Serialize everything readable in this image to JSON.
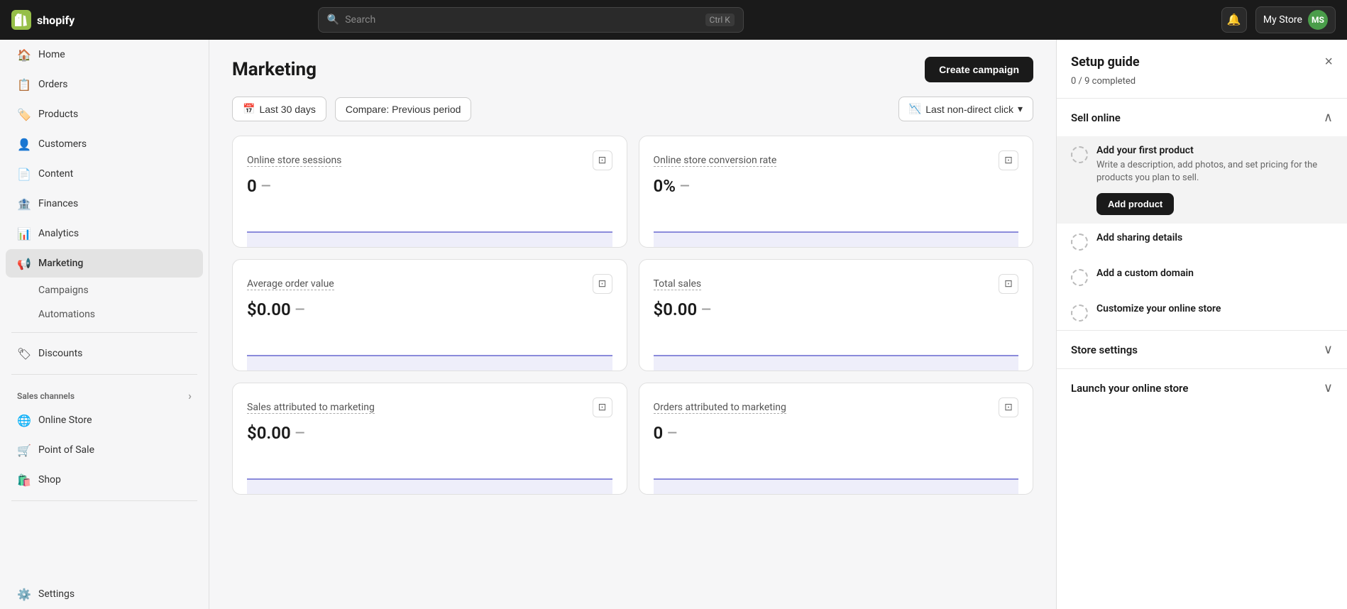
{
  "topnav": {
    "logo_text": "shopify",
    "logo_initials": "S",
    "search_placeholder": "Search",
    "search_shortcut": "Ctrl K",
    "store_name": "My Store",
    "avatar_initials": "MS"
  },
  "sidebar": {
    "items": [
      {
        "id": "home",
        "label": "Home",
        "icon": "🏠"
      },
      {
        "id": "orders",
        "label": "Orders",
        "icon": "📋"
      },
      {
        "id": "products",
        "label": "Products",
        "icon": "🏷️"
      },
      {
        "id": "customers",
        "label": "Customers",
        "icon": "👤"
      },
      {
        "id": "content",
        "label": "Content",
        "icon": "📄"
      },
      {
        "id": "finances",
        "label": "Finances",
        "icon": "🏦"
      },
      {
        "id": "analytics",
        "label": "Analytics",
        "icon": "📊"
      },
      {
        "id": "marketing",
        "label": "Marketing",
        "icon": "📢",
        "active": true
      }
    ],
    "marketing_sub_items": [
      {
        "id": "campaigns",
        "label": "Campaigns"
      },
      {
        "id": "automations",
        "label": "Automations"
      }
    ],
    "items2": [
      {
        "id": "discounts",
        "label": "Discounts",
        "icon": "🏷"
      }
    ],
    "sales_channels_label": "Sales channels",
    "sales_channels": [
      {
        "id": "online-store",
        "label": "Online Store",
        "icon": "🌐"
      },
      {
        "id": "point-of-sale",
        "label": "Point of Sale",
        "icon": "🛒"
      },
      {
        "id": "shop",
        "label": "Shop",
        "icon": "🛍️"
      }
    ],
    "settings": {
      "label": "Settings",
      "icon": "⚙️"
    }
  },
  "main": {
    "title": "Marketing",
    "create_btn": "Create campaign",
    "filters": {
      "date_range": "Last 30 days",
      "compare": "Compare: Previous period",
      "attribution": "Last non-direct click"
    },
    "metrics": [
      {
        "label": "Online store sessions",
        "value": "0",
        "dash": "—"
      },
      {
        "label": "Online store conversion rate",
        "value": "0%",
        "dash": "—"
      },
      {
        "label": "Average order value",
        "value": "$0.00",
        "dash": "—"
      },
      {
        "label": "Total sales",
        "value": "$0.00",
        "dash": "—"
      },
      {
        "label": "Sales attributed to marketing",
        "value": "$0.00",
        "dash": "—"
      },
      {
        "label": "Orders attributed to marketing",
        "value": "0",
        "dash": "—"
      }
    ]
  },
  "setup_guide": {
    "title": "Setup guide",
    "progress": "0 / 9 completed",
    "close_label": "×",
    "sections": [
      {
        "id": "sell-online",
        "title": "Sell online",
        "expanded": true,
        "items": [
          {
            "id": "add-first-product",
            "title": "Add your first product",
            "description": "Write a description, add photos, and set pricing for the products you plan to sell.",
            "btn_label": "Add product",
            "highlighted": true
          },
          {
            "id": "add-sharing-details",
            "title": "Add sharing details",
            "description": "",
            "btn_label": "",
            "highlighted": false
          },
          {
            "id": "add-custom-domain",
            "title": "Add a custom domain",
            "description": "",
            "btn_label": "",
            "highlighted": false
          },
          {
            "id": "customize-online-store",
            "title": "Customize your online store",
            "description": "",
            "btn_label": "",
            "highlighted": false
          }
        ]
      },
      {
        "id": "store-settings",
        "title": "Store settings",
        "expanded": false,
        "items": []
      },
      {
        "id": "launch-online-store",
        "title": "Launch your online store",
        "expanded": false,
        "items": []
      }
    ]
  }
}
